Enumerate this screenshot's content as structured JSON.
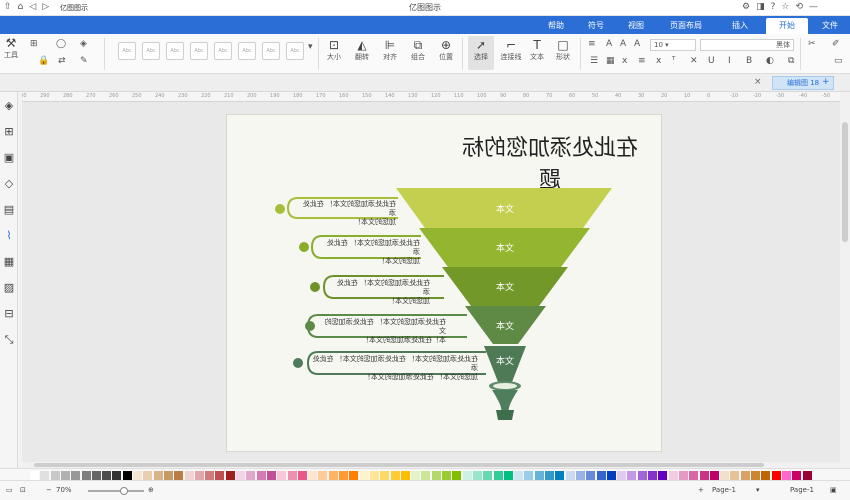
{
  "window": {
    "title": "亿图图示"
  },
  "titlebar_icons_left": [
    "⇧",
    "⌂",
    "◁",
    "▷",
    "≡",
    "▾"
  ],
  "titlebar_left_label": "亿图图示",
  "titlebar_icons_right": [
    "⚙",
    "◨",
    "?",
    "☆",
    "⟲",
    "—"
  ],
  "tabs": [
    {
      "label": "文件",
      "active": false
    },
    {
      "label": "开始",
      "active": true
    },
    {
      "label": "插入",
      "active": false
    },
    {
      "label": "页面布局",
      "active": false
    },
    {
      "label": "视图",
      "active": false
    },
    {
      "label": "符号",
      "active": false
    },
    {
      "label": "帮助",
      "active": false
    }
  ],
  "ribbon": {
    "font_name": "黑体",
    "font_size": "10",
    "buttons": {
      "select": "选择",
      "connector": "连接线",
      "text": "文本",
      "shape": "形状",
      "position": "位置",
      "combine": "组合",
      "align": "对齐",
      "rotate": "翻转",
      "size": "大小",
      "tools": "工具"
    },
    "style_boxes": [
      "Abc",
      "Abc",
      "Abc",
      "Abc",
      "Abc",
      "Abc",
      "Abc",
      "Abc",
      "Abc"
    ]
  },
  "doc_tab": {
    "label": "编辑图 18",
    "close": "×"
  },
  "ruler_labels": [
    "-50",
    "-40",
    "-30",
    "-20",
    "-10",
    "0",
    "10",
    "20",
    "30",
    "40",
    "50",
    "60",
    "70",
    "80",
    "90",
    "100",
    "110",
    "120",
    "130",
    "140",
    "150",
    "160",
    "170",
    "180",
    "190",
    "200",
    "210",
    "220",
    "230",
    "240",
    "250",
    "260",
    "270",
    "280",
    "290",
    "300"
  ],
  "sidebar_icons": [
    "fill-icon",
    "grid-icon",
    "image-icon",
    "layers-icon",
    "page-icon",
    "chart-icon",
    "table-icon",
    "media-icon",
    "format-icon",
    "fit-icon"
  ],
  "diagram": {
    "title": "在此处添加您的标题",
    "stages": [
      {
        "label": "文本",
        "color": "#c3cf4e"
      },
      {
        "label": "文本",
        "color": "#93b52f"
      },
      {
        "label": "文本",
        "color": "#73982a"
      },
      {
        "label": "文本",
        "color": "#5f8a45"
      },
      {
        "label": "文本",
        "color": "#4e7a55"
      }
    ],
    "descriptions": [
      {
        "line1": "在此处添加您的文本！ 在此处添",
        "line2": "加您的文本！",
        "color": "#a6bf3a"
      },
      {
        "line1": "在此处添加您的文本！ 在此处添",
        "line2": "加您的文本！",
        "color": "#8aad2c"
      },
      {
        "line1": "在此处添加您的文本！ 在此处添",
        "line2": "加您的文本！",
        "color": "#6e922a"
      },
      {
        "line1": "在此处添加您的文本！ 在此处添加您的文",
        "line2": "本！在此处添加您的文本！",
        "color": "#5c8a48"
      },
      {
        "line1": "在此处添加您的文本！ 在此处添加您的文本！ 在此处添",
        "line2": "加您的文本！ 在此处添加您的文本！",
        "color": "#4d7a58"
      }
    ]
  },
  "palette": [
    "#ffffff",
    "#e0e0e0",
    "#c8c8c8",
    "#b0b0b0",
    "#989898",
    "#7f7f7f",
    "#666666",
    "#4d4d4d",
    "#333333",
    "#000000",
    "#f5e6d3",
    "#e8cfb0",
    "#d9b38c",
    "#c99868",
    "#b87d45",
    "#f0d4d4",
    "#e0a8a8",
    "#d07c7c",
    "#c05050",
    "#a02020",
    "#f2d4e6",
    "#e2a8cc",
    "#d27cb2",
    "#c25098",
    "#f8c8d8",
    "#f090b0",
    "#e85888",
    "#ffe6cc",
    "#ffcc99",
    "#ffb366",
    "#ff9933",
    "#ff8000",
    "#fff2cc",
    "#ffe699",
    "#ffd966",
    "#ffcc33",
    "#ffbf00",
    "#e6f2cc",
    "#cce699",
    "#b3d966",
    "#99cc33",
    "#80bf00",
    "#ccf2e6",
    "#99e6cc",
    "#66d9b3",
    "#33cc99",
    "#00bf80",
    "#cce6f2",
    "#99cce6",
    "#66b3d9",
    "#3399cc",
    "#0080bf",
    "#ccd9f2",
    "#99b3e6",
    "#668cd9",
    "#3366cc",
    "#0040bf",
    "#e0ccf2",
    "#c299e6",
    "#a366d9",
    "#8533cc",
    "#6600bf",
    "#f2cce0",
    "#e699c2",
    "#d966a3",
    "#cc3385",
    "#bf0066",
    "#f2e0cc",
    "#e6c299",
    "#d9a366",
    "#cc8533",
    "#bf6600",
    "#ff0000",
    "#ff66cc",
    "#cc0066",
    "#990033"
  ],
  "status": {
    "page_label": "Page-1",
    "page_tab": "Page-1",
    "zoom": "70%",
    "add_page": "+",
    "fit_icon": "⊡"
  }
}
